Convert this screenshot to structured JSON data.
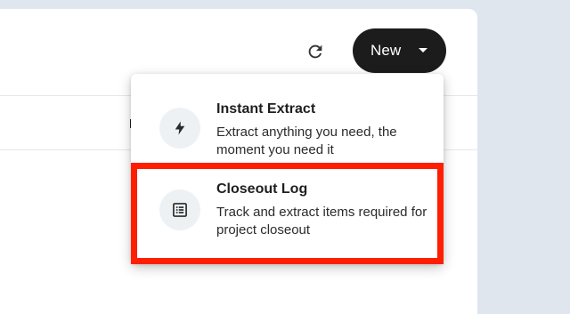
{
  "toolbar": {
    "new_label": "New",
    "refresh_icon": "refresh-icon",
    "caret_icon": "caret-down-icon"
  },
  "table": {
    "column_fragment": "I"
  },
  "menu": {
    "items": [
      {
        "title": "Instant Extract",
        "description": "Extract anything you need, the moment you need it",
        "icon": "lightning-bolt-icon"
      },
      {
        "title": "Closeout Log",
        "description": "Track and extract items required for project closeout",
        "icon": "list-document-icon",
        "highlighted": true
      }
    ]
  },
  "colors": {
    "highlight": "#ff1e00",
    "button_bg": "#1c1c1c",
    "page_bg": "#dfe6ee"
  }
}
